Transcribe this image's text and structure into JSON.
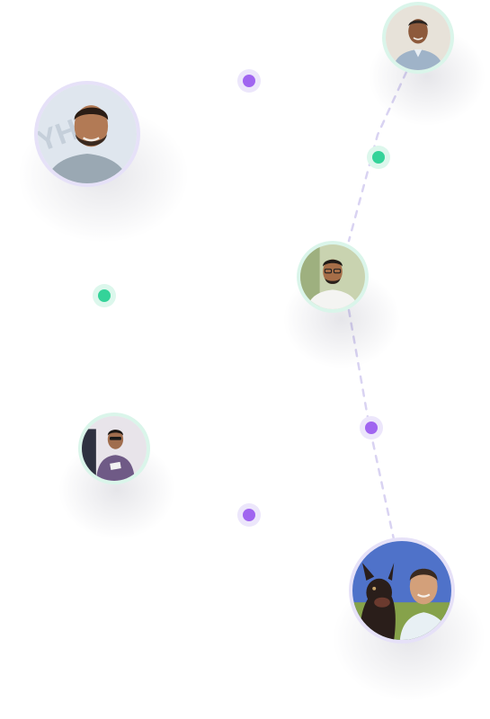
{
  "colors": {
    "purple_ring": "#ece6fb",
    "purple_core": "#a065f0",
    "green_ring": "#dcf7ec",
    "green_core": "#34d399",
    "avatar_ring_purple": "#e6e1f8",
    "avatar_ring_green": "#daf5ea",
    "dashed_line": "#d9d3f2"
  },
  "avatars": [
    {
      "name": "avatar-top-right",
      "ring": "green",
      "icon": "person-photo"
    },
    {
      "name": "avatar-upper-left",
      "ring": "purple",
      "icon": "person-photo"
    },
    {
      "name": "avatar-middle-right",
      "ring": "green",
      "icon": "person-photo"
    },
    {
      "name": "avatar-lower-left",
      "ring": "green",
      "icon": "person-photo"
    },
    {
      "name": "avatar-bottom-right",
      "ring": "purple",
      "icon": "person-with-dog-photo"
    }
  ]
}
